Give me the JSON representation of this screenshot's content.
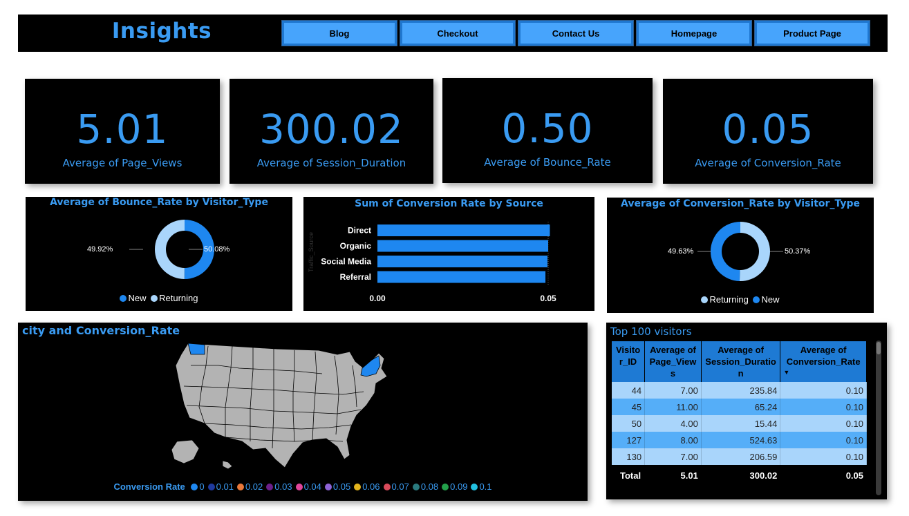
{
  "header": {
    "title": "Insights",
    "nav": [
      "Blog",
      "Checkout",
      "Contact Us",
      "Homepage",
      "Product Page"
    ]
  },
  "kpis": [
    {
      "value": "5.01",
      "label": "Average of Page_Views"
    },
    {
      "value": "300.02",
      "label": "Average of Session_Duration"
    },
    {
      "value": "0.50",
      "label": "Average of Bounce_Rate"
    },
    {
      "value": "0.05",
      "label": "Average of Conversion_Rate"
    }
  ],
  "colors": {
    "accent": "#3a9bf2",
    "bar": "#1e87f0",
    "light": "#a9d5fb",
    "dark": "#1e87f0"
  },
  "donut_bounce": {
    "title": "Average of Bounce_Rate by Visitor_Type",
    "left_pct": "49.92%",
    "right_pct": "50.08%",
    "legend": [
      "New",
      "Returning"
    ]
  },
  "bar_panel": {
    "title": "Sum of Conversion Rate by Source",
    "ylabel": "Traffic_Source",
    "xticks": [
      "0.00",
      "0.05"
    ]
  },
  "donut_conv": {
    "title": "Average of Conversion_Rate by Visitor_Type",
    "left_pct": "49.63%",
    "right_pct": "50.37%",
    "legend": [
      "Returning",
      "New"
    ]
  },
  "map_panel": {
    "title": "city and Conversion_Rate",
    "legend_title": "Conversion Rate",
    "legend_items": [
      {
        "label": "0",
        "color": "#1e87f0"
      },
      {
        "label": "0.01",
        "color": "#1f3a9e"
      },
      {
        "label": "0.02",
        "color": "#e8783a"
      },
      {
        "label": "0.03",
        "color": "#6b1f8a"
      },
      {
        "label": "0.04",
        "color": "#e0459a"
      },
      {
        "label": "0.05",
        "color": "#8e63d6"
      },
      {
        "label": "0.06",
        "color": "#e3b41d"
      },
      {
        "label": "0.07",
        "color": "#d94a5a"
      },
      {
        "label": "0.08",
        "color": "#2a7a7e"
      },
      {
        "label": "0.09",
        "color": "#23a04a"
      },
      {
        "label": "0.1",
        "color": "#22c0e0"
      }
    ]
  },
  "table_panel": {
    "title": "Top 100 visitors",
    "columns": [
      "Visito r_ID",
      "Average of Page_View s",
      "Average of Session_Duratio n",
      "Average of Conversion_Rate"
    ],
    "rows": [
      [
        "44",
        "7.00",
        "235.84",
        "0.10"
      ],
      [
        "45",
        "11.00",
        "65.24",
        "0.10"
      ],
      [
        "50",
        "4.00",
        "15.44",
        "0.10"
      ],
      [
        "127",
        "8.00",
        "524.63",
        "0.10"
      ],
      [
        "130",
        "7.00",
        "206.59",
        "0.10"
      ]
    ],
    "total": [
      "Total",
      "5.01",
      "300.02",
      "0.05"
    ]
  },
  "chart_data": [
    {
      "type": "pie",
      "title": "Average of Bounce_Rate by Visitor_Type",
      "categories": [
        "New",
        "Returning"
      ],
      "values": [
        50.08,
        49.92
      ],
      "colors": [
        "#1e87f0",
        "#a9d5fb"
      ]
    },
    {
      "type": "bar",
      "title": "Sum of Conversion Rate by Source",
      "ylabel": "Traffic_Source",
      "xlabel": "",
      "categories": [
        "Direct",
        "Organic",
        "Social Media",
        "Referral"
      ],
      "values": [
        0.0505,
        0.05,
        0.0498,
        0.0492
      ],
      "xlim": [
        0,
        0.05
      ],
      "orientation": "horizontal"
    },
    {
      "type": "pie",
      "title": "Average of Conversion_Rate by Visitor_Type",
      "categories": [
        "Returning",
        "New"
      ],
      "values": [
        50.37,
        49.63
      ],
      "colors": [
        "#a9d5fb",
        "#1e87f0"
      ]
    }
  ]
}
